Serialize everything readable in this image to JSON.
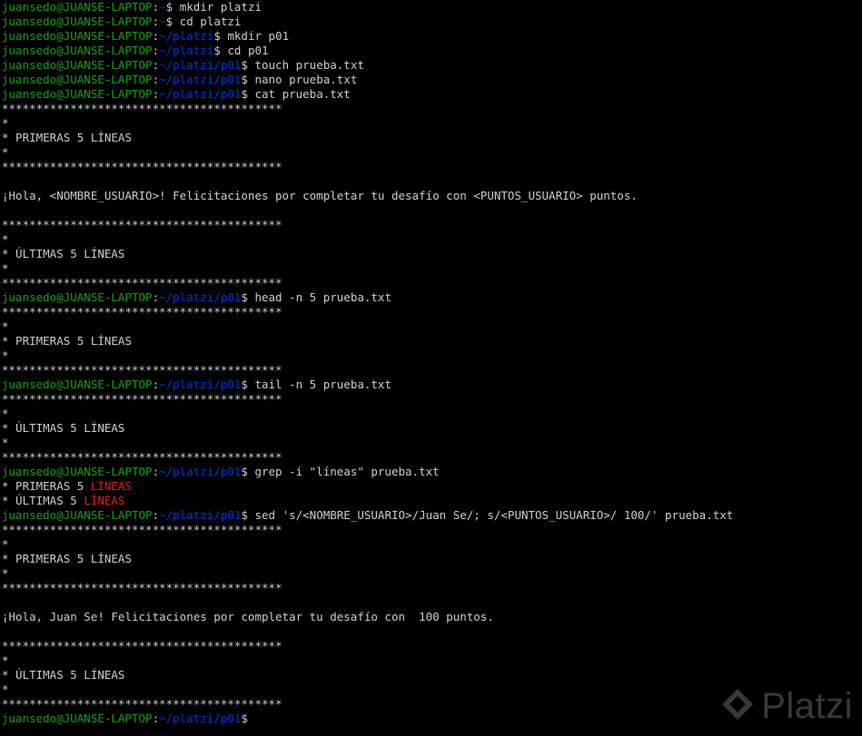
{
  "colors": {
    "background": "#000000",
    "text": "#cccccc",
    "user": "#13a10e",
    "path": "#0037da",
    "match": "#e01b24"
  },
  "watermark": {
    "icon": "platzi-logo-icon",
    "text": "Platzi"
  },
  "lines": [
    [
      {
        "t": "juansedo@JUANSE-LAPTOP",
        "c": "user"
      },
      {
        "t": ":",
        "c": "plain"
      },
      {
        "t": "~",
        "c": "path"
      },
      {
        "t": "$ mkdir platzi",
        "c": "plain"
      }
    ],
    [
      {
        "t": "juansedo@JUANSE-LAPTOP",
        "c": "user"
      },
      {
        "t": ":",
        "c": "plain"
      },
      {
        "t": "~",
        "c": "path"
      },
      {
        "t": "$ cd platzi",
        "c": "plain"
      }
    ],
    [
      {
        "t": "juansedo@JUANSE-LAPTOP",
        "c": "user"
      },
      {
        "t": ":",
        "c": "plain"
      },
      {
        "t": "~/platzi",
        "c": "path"
      },
      {
        "t": "$ mkdir p01",
        "c": "plain"
      }
    ],
    [
      {
        "t": "juansedo@JUANSE-LAPTOP",
        "c": "user"
      },
      {
        "t": ":",
        "c": "plain"
      },
      {
        "t": "~/platzi",
        "c": "path"
      },
      {
        "t": "$ cd p01",
        "c": "plain"
      }
    ],
    [
      {
        "t": "juansedo@JUANSE-LAPTOP",
        "c": "user"
      },
      {
        "t": ":",
        "c": "plain"
      },
      {
        "t": "~/platzi/p01",
        "c": "path"
      },
      {
        "t": "$ touch prueba.txt",
        "c": "plain"
      }
    ],
    [
      {
        "t": "juansedo@JUANSE-LAPTOP",
        "c": "user"
      },
      {
        "t": ":",
        "c": "plain"
      },
      {
        "t": "~/platzi/p01",
        "c": "path"
      },
      {
        "t": "$ nano prueba.txt",
        "c": "plain"
      }
    ],
    [
      {
        "t": "juansedo@JUANSE-LAPTOP",
        "c": "user"
      },
      {
        "t": ":",
        "c": "plain"
      },
      {
        "t": "~/platzi/p01",
        "c": "path"
      },
      {
        "t": "$ cat prueba.txt",
        "c": "plain"
      }
    ],
    [
      {
        "t": "*****************************************",
        "c": "plain"
      }
    ],
    [
      {
        "t": "*",
        "c": "plain"
      }
    ],
    [
      {
        "t": "* PRIMERAS 5 LÍNEAS",
        "c": "plain"
      }
    ],
    [
      {
        "t": "*",
        "c": "plain"
      }
    ],
    [
      {
        "t": "*****************************************",
        "c": "plain"
      }
    ],
    [],
    [
      {
        "t": "¡Hola, <NOMBRE_USUARIO>! Felicitaciones por completar tu desafío con <PUNTOS_USUARIO> puntos.",
        "c": "plain"
      }
    ],
    [],
    [
      {
        "t": "*****************************************",
        "c": "plain"
      }
    ],
    [
      {
        "t": "*",
        "c": "plain"
      }
    ],
    [
      {
        "t": "* ÚLTIMAS 5 LÍNEAS",
        "c": "plain"
      }
    ],
    [
      {
        "t": "*",
        "c": "plain"
      }
    ],
    [
      {
        "t": "*****************************************",
        "c": "plain"
      }
    ],
    [
      {
        "t": "juansedo@JUANSE-LAPTOP",
        "c": "user"
      },
      {
        "t": ":",
        "c": "plain"
      },
      {
        "t": "~/platzi/p01",
        "c": "path"
      },
      {
        "t": "$ head -n 5 prueba.txt",
        "c": "plain"
      }
    ],
    [
      {
        "t": "*****************************************",
        "c": "plain"
      }
    ],
    [
      {
        "t": "*",
        "c": "plain"
      }
    ],
    [
      {
        "t": "* PRIMERAS 5 LÍNEAS",
        "c": "plain"
      }
    ],
    [
      {
        "t": "*",
        "c": "plain"
      }
    ],
    [
      {
        "t": "*****************************************",
        "c": "plain"
      }
    ],
    [
      {
        "t": "juansedo@JUANSE-LAPTOP",
        "c": "user"
      },
      {
        "t": ":",
        "c": "plain"
      },
      {
        "t": "~/platzi/p01",
        "c": "path"
      },
      {
        "t": "$ tail -n 5 prueba.txt",
        "c": "plain"
      }
    ],
    [
      {
        "t": "*****************************************",
        "c": "plain"
      }
    ],
    [
      {
        "t": "*",
        "c": "plain"
      }
    ],
    [
      {
        "t": "* ÚLTIMAS 5 LÍNEAS",
        "c": "plain"
      }
    ],
    [
      {
        "t": "*",
        "c": "plain"
      }
    ],
    [
      {
        "t": "*****************************************",
        "c": "plain"
      }
    ],
    [
      {
        "t": "juansedo@JUANSE-LAPTOP",
        "c": "user"
      },
      {
        "t": ":",
        "c": "plain"
      },
      {
        "t": "~/platzi/p01",
        "c": "path"
      },
      {
        "t": "$ grep -i \"líneas\" prueba.txt",
        "c": "plain"
      }
    ],
    [
      {
        "t": "* PRIMERAS 5 ",
        "c": "plain"
      },
      {
        "t": "LÍNEAS",
        "c": "red"
      }
    ],
    [
      {
        "t": "* ÚLTIMAS 5 ",
        "c": "plain"
      },
      {
        "t": "LÍNEAS",
        "c": "red"
      }
    ],
    [
      {
        "t": "juansedo@JUANSE-LAPTOP",
        "c": "user"
      },
      {
        "t": ":",
        "c": "plain"
      },
      {
        "t": "~/platzi/p01",
        "c": "path"
      },
      {
        "t": "$ sed 's/<NOMBRE_USUARIO>/Juan Se/; s/<PUNTOS_USUARIO>/ 100/' prueba.txt",
        "c": "plain"
      }
    ],
    [
      {
        "t": "*****************************************",
        "c": "plain"
      }
    ],
    [
      {
        "t": "*",
        "c": "plain"
      }
    ],
    [
      {
        "t": "* PRIMERAS 5 LÍNEAS",
        "c": "plain"
      }
    ],
    [
      {
        "t": "*",
        "c": "plain"
      }
    ],
    [
      {
        "t": "*****************************************",
        "c": "plain"
      }
    ],
    [],
    [
      {
        "t": "¡Hola, Juan Se! Felicitaciones por completar tu desafío con  100 puntos.",
        "c": "plain"
      }
    ],
    [],
    [
      {
        "t": "*****************************************",
        "c": "plain"
      }
    ],
    [
      {
        "t": "*",
        "c": "plain"
      }
    ],
    [
      {
        "t": "* ÚLTIMAS 5 LÍNEAS",
        "c": "plain"
      }
    ],
    [
      {
        "t": "*",
        "c": "plain"
      }
    ],
    [
      {
        "t": "*****************************************",
        "c": "plain"
      }
    ],
    [
      {
        "t": "juansedo@JUANSE-LAPTOP",
        "c": "user"
      },
      {
        "t": ":",
        "c": "plain"
      },
      {
        "t": "~/platzi/p01",
        "c": "path"
      },
      {
        "t": "$",
        "c": "plain"
      }
    ]
  ]
}
